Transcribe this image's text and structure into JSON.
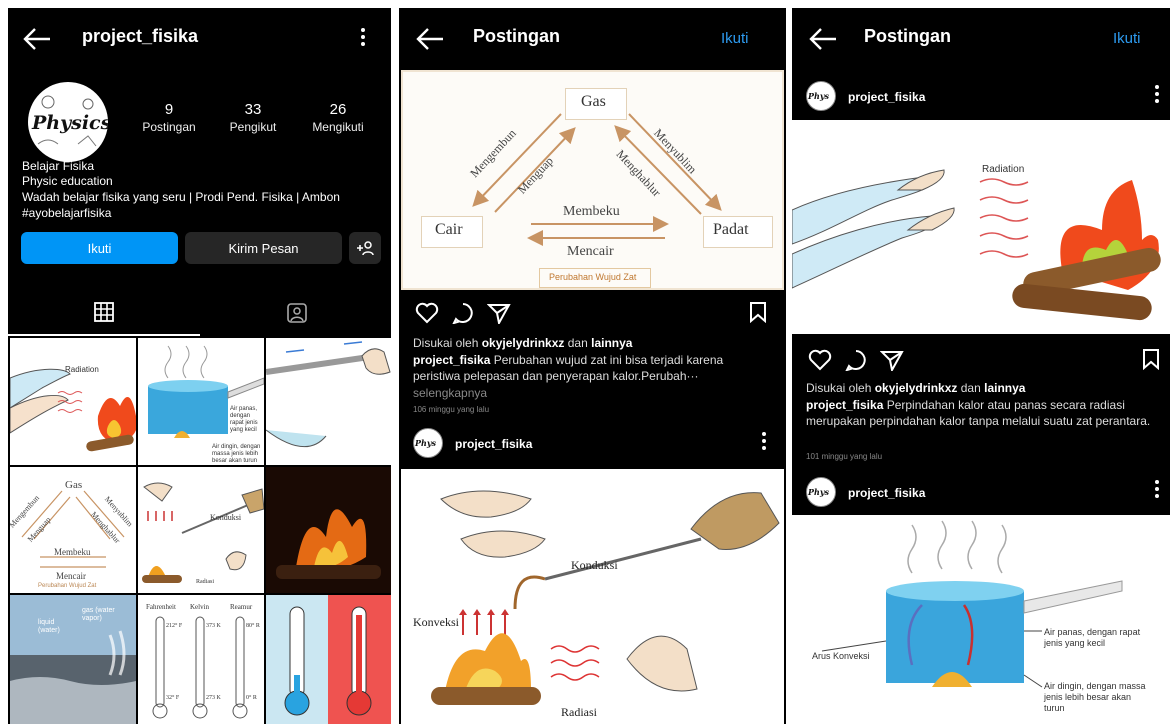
{
  "profile": {
    "username": "project_fisika",
    "avatar_text": "Physics",
    "stats": [
      {
        "num": "9",
        "label": "Postingan"
      },
      {
        "num": "33",
        "label": "Pengikut"
      },
      {
        "num": "26",
        "label": "Mengikuti"
      }
    ],
    "bio": [
      "Belajar Fisika",
      "Physic education",
      "Wadah belajar fisika yang seru | Prodi Pend. Fisika | Ambon",
      "#ayobelajarfisika"
    ],
    "follow_btn": "Ikuti",
    "message_btn": "Kirim Pesan",
    "add_user": "+"
  },
  "grid_texts": {
    "radiation": "Radiation",
    "gas": "Gas",
    "mengembun": "Mengembun",
    "menguap": "Menguap",
    "menyublim": "Menyublim",
    "menghablur": "Menghablur",
    "membeku": "Membeku",
    "mencair": "Mencair",
    "perubahan": "Perubahan Wujud Zat",
    "konduksi": "Konduksi",
    "radiasi": "Radiasi",
    "air_panas_small": "Air panas, dengan rapat jenis yang kecil",
    "air_dingin_small": "Air dingin, dengan massa jenis lebih besar akan turun",
    "liquid": "liquid (water)",
    "gas_vapor": "gas (water vapor)",
    "fahrenheit": "Fahrenheit",
    "kelvin": "Kelvin",
    "reamur": "Reamur",
    "t212": "212° F",
    "t373": "373 K",
    "t80": "80° R",
    "t32": "32° F",
    "t273": "273 K",
    "t0": "0° R"
  },
  "post1": {
    "header": "Postingan",
    "follow": "Ikuti",
    "diagram": {
      "gas": "Gas",
      "cair": "Cair",
      "padat": "Padat",
      "mengembun": "Mengembun",
      "menguap": "Menguap",
      "menyublim": "Menyublim",
      "menghablur": "Menghablur",
      "membeku": "Membeku",
      "mencair": "Mencair",
      "caption": "Perubahan Wujud Zat"
    },
    "liked_prefix": "Disukai oleh ",
    "liked_user": "okyjelydrinkxz",
    "liked_mid": " dan ",
    "liked_rest": "lainnya",
    "caption_user": "project_fisika",
    "caption_text": " Perubahan wujud zat ini bisa terjadi karena peristiwa pelepasan dan penyerapan kalor.Perubah···",
    "more": "selengkapnya",
    "time": "106 minggu yang lalu",
    "next_user": "project_fisika",
    "next_labels": {
      "konduksi": "Konduksi",
      "konveksi": "Konveksi",
      "radiasi": "Radiasi"
    }
  },
  "post2": {
    "header": "Postingan",
    "follow": "Ikuti",
    "user": "project_fisika",
    "radiation": "Radiation",
    "liked_prefix": "Disukai oleh ",
    "liked_user": "okyjelydrinkxz",
    "liked_mid": " dan ",
    "liked_rest": "lainnya",
    "caption_user": "project_fisika",
    "caption_text": " Perpindahan kalor atau panas secara radiasi merupakan perpindahan kalor tanpa melalui suatu zat perantara.",
    "time": "101 minggu yang lalu",
    "next_user": "project_fisika",
    "arus": "Arus Konveksi",
    "air_panas": "Air panas, dengan rapat jenis yang kecil",
    "air_dingin": "Air dingin, dengan massa jenis lebih besar akan turun"
  },
  "colors": {
    "accent": "#0095f6",
    "link": "#2d9bf0",
    "fire": "#f04a1c"
  }
}
